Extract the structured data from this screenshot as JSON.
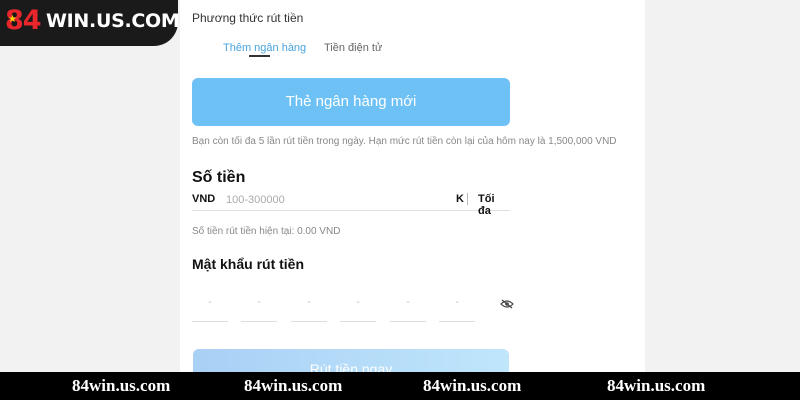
{
  "logo": {
    "number": "84",
    "text": "WIN.US.COM",
    "star": "★"
  },
  "withdraw": {
    "section_title": "Phương thức rút tiền",
    "tabs": [
      {
        "label": "Thêm ngân hàng",
        "active": true
      },
      {
        "label": "Tiền điện tử",
        "active": false
      }
    ],
    "new_card_label": "Thẻ ngân hàng mới",
    "limit_note": "Bạn còn tối đa 5 lần rút tiền trong ngày. Hạn mức rút tiền còn lại của hôm nay là 1,500,000 VND"
  },
  "amount": {
    "title": "Số tiền",
    "currency": "VND",
    "placeholder": "100-300000",
    "unit": "K",
    "max_label": "Tối đa",
    "current_label": "Số tiền rút tiền hiện tại: 0.00 VND"
  },
  "password": {
    "title": "Mật khẩu rút tiền",
    "pins": [
      "-",
      "-",
      "-",
      "-",
      "-",
      "-"
    ],
    "eye_icon": "eye-hidden-icon"
  },
  "submit_label": "Rút tiền ngay",
  "footer": {
    "items": [
      "84win.us.com",
      "84win.us.com",
      "84win.us.com",
      "84win.us.com"
    ]
  },
  "colors": {
    "accent": "#6ec1f5",
    "tab_active": "#4aa3df",
    "logo_red": "#e8262b",
    "footer_bg": "#000000"
  }
}
